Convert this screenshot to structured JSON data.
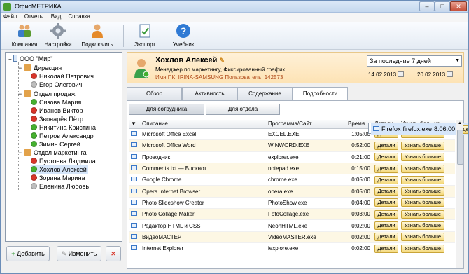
{
  "window": {
    "title": "ОфисМЕТРИКА",
    "min": "–",
    "max": "□",
    "close": "✕"
  },
  "menu": [
    "Файл",
    "Отчеты",
    "Вид",
    "Справка"
  ],
  "toolbar": {
    "company": "Компания",
    "settings": "Настройки",
    "connect": "Подключить",
    "export": "Экспорт",
    "tutorial": "Учебник"
  },
  "tree": {
    "root": "ООО \"Мир\"",
    "groups": [
      {
        "name": "Дирекция",
        "users": [
          {
            "name": "Николай Петрович",
            "status": "red"
          },
          {
            "name": "Егор Олегович",
            "status": "grey"
          }
        ]
      },
      {
        "name": "Отдел продаж",
        "users": [
          {
            "name": "Сизова Мария",
            "status": "green"
          },
          {
            "name": "Иванов Виктор",
            "status": "red"
          },
          {
            "name": "Звонарёв Пётр",
            "status": "red"
          },
          {
            "name": "Никитина Кристина",
            "status": "green"
          },
          {
            "name": "Петров Александр",
            "status": "green"
          },
          {
            "name": "Зимин Сергей",
            "status": "green"
          }
        ]
      },
      {
        "name": "Отдел маркетинга",
        "users": [
          {
            "name": "Пустоева Людмила",
            "status": "red"
          },
          {
            "name": "Хохлов Алексей",
            "status": "green"
          },
          {
            "name": "Зорина Марина",
            "status": "red"
          },
          {
            "name": "Еленина Любовь",
            "status": "grey"
          }
        ]
      }
    ]
  },
  "left_buttons": {
    "add": "Добавить",
    "edit": "Изменить",
    "delete": "✕"
  },
  "employee": {
    "name": "Хохлов Алексей",
    "description": "Менеджер по маркетингу, Фиксированный график",
    "pc_info": "Имя ПК: IRINA-SAMSUNG Пользователь: 142573"
  },
  "period": {
    "selected": "За последние 7 дней",
    "from": "14.02.2013",
    "to": "20.02.2013"
  },
  "tabs": [
    "Обзор",
    "Активность",
    "Содержание",
    "Подробности"
  ],
  "subtabs": {
    "employee": "Для сотрудника",
    "department": "Для отдела"
  },
  "table": {
    "headers": {
      "desc": "Описание",
      "program": "Программа/Сайт",
      "time": "Время",
      "details": "Детали",
      "more": "Узнать больше"
    },
    "details_label": "Детали",
    "more_label": "Узнать больше",
    "rows": [
      {
        "desc": "Firefox",
        "program": "firefox.exe",
        "time": "8:06:00"
      },
      {
        "desc": "Microsoft Office Excel",
        "program": "EXCEL.EXE",
        "time": "1:05:00"
      },
      {
        "desc": "Microsoft Office Word",
        "program": "WINWORD.EXE",
        "time": "0:52:00"
      },
      {
        "desc": "Проводник",
        "program": "explorer.exe",
        "time": "0:21:00"
      },
      {
        "desc": "Comments.txt — Блокнот",
        "program": "notepad.exe",
        "time": "0:15:00"
      },
      {
        "desc": "Google Chrome",
        "program": "chrome.exe",
        "time": "0:05:00"
      },
      {
        "desc": "Opera Internet Browser",
        "program": "opera.exe",
        "time": "0:05:00"
      },
      {
        "desc": "Photo Slideshow Creator",
        "program": "PhotoShow.exe",
        "time": "0:04:00"
      },
      {
        "desc": "Photo Collage Maker",
        "program": "FotoCollage.exe",
        "time": "0:03:00"
      },
      {
        "desc": "Редактор HTML и CSS",
        "program": "NeonHTML.exe",
        "time": "0:02:00"
      },
      {
        "desc": "ВидеоМАСТЕР",
        "program": "VideoMASTER.exe",
        "time": "0:02:00"
      },
      {
        "desc": "Internet Explorer",
        "program": "iexplore.exe",
        "time": "0:02:00"
      }
    ]
  }
}
